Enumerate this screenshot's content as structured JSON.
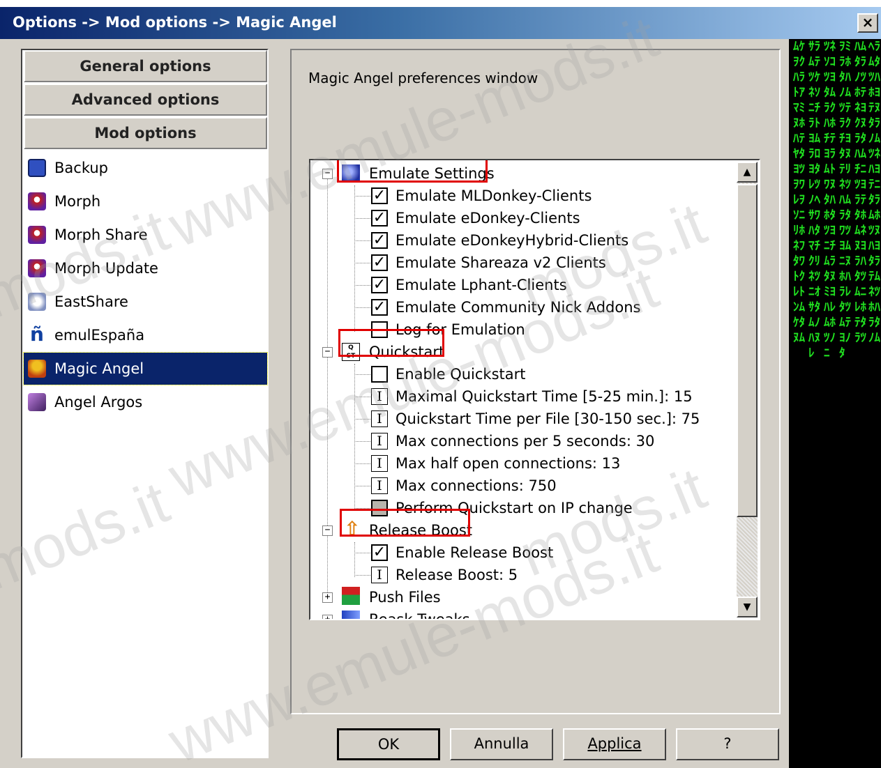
{
  "window": {
    "title": "Options -> Mod options -> Magic Angel",
    "close_label": "×"
  },
  "nav": {
    "groups": [
      {
        "label": "General options"
      },
      {
        "label": "Advanced options"
      },
      {
        "label": "Mod options"
      }
    ],
    "items": [
      {
        "label": "Backup",
        "icon": "floppy-disk-icon",
        "color": "#3050c0"
      },
      {
        "label": "Morph",
        "icon": "morph-mascot-icon",
        "color": "#c02020"
      },
      {
        "label": "Morph Share",
        "icon": "morph-mascot-icon",
        "color": "#c02020"
      },
      {
        "label": "Morph Update",
        "icon": "morph-mascot-icon",
        "color": "#c02020"
      },
      {
        "label": "EastShare",
        "icon": "eastshare-icon",
        "color": "#8090c0"
      },
      {
        "label": "emulEspaña",
        "icon": "n-tilde-icon",
        "color": "#1040a0"
      },
      {
        "label": "Magic Angel",
        "icon": "angel-icon",
        "color": "#f0c020",
        "selected": true
      },
      {
        "label": "Angel Argos",
        "icon": "argos-pyramid-icon",
        "color": "#8040a0"
      }
    ]
  },
  "main": {
    "description": "Magic Angel preferences window",
    "tree": {
      "groups": [
        {
          "label": "Emulate Settings",
          "icon": "emulate-icon",
          "expander": "−",
          "children": [
            {
              "type": "check",
              "checked": true,
              "label": "Emulate MLDonkey-Clients"
            },
            {
              "type": "check",
              "checked": true,
              "label": "Emulate eDonkey-Clients"
            },
            {
              "type": "check",
              "checked": true,
              "label": "Emulate eDonkeyHybrid-Clients"
            },
            {
              "type": "check",
              "checked": true,
              "label": "Emulate Shareaza v2 Clients"
            },
            {
              "type": "check",
              "checked": true,
              "label": "Emulate Lphant-Clients"
            },
            {
              "type": "check",
              "checked": true,
              "label": "Emulate Community Nick Addons"
            },
            {
              "type": "check",
              "checked": false,
              "label": "Log for Emulation"
            }
          ]
        },
        {
          "label": "Quickstart",
          "icon": "quickstart-icon",
          "expander": "−",
          "children": [
            {
              "type": "check",
              "checked": false,
              "label": "Enable Quickstart"
            },
            {
              "type": "input",
              "label": "Maximal Quickstart Time [5-25 min.]: 15"
            },
            {
              "type": "input",
              "label": "Quickstart Time per File [30-150 sec.]: 75"
            },
            {
              "type": "input",
              "label": "Max connections per 5 seconds: 30"
            },
            {
              "type": "input",
              "label": "Max half open connections: 13"
            },
            {
              "type": "input",
              "label": "Max connections: 750"
            },
            {
              "type": "check",
              "checked": false,
              "disabled": true,
              "label": "Perform Quickstart on IP change"
            }
          ]
        },
        {
          "label": "Release Boost",
          "icon": "release-boost-arrow-icon",
          "expander": "−",
          "children": [
            {
              "type": "check",
              "checked": true,
              "label": "Enable Release Boost"
            },
            {
              "type": "input",
              "label": "Release Boost: 5"
            }
          ]
        },
        {
          "label": "Push Files",
          "icon": "push-files-icon",
          "expander": "+",
          "children": []
        },
        {
          "label": "Reask Tweaks",
          "icon": "reask-tweaks-icon",
          "expander": "+",
          "children": []
        }
      ]
    }
  },
  "buttons": {
    "ok": "OK",
    "cancel": "Annulla",
    "apply": "Applica",
    "help": "?"
  },
  "watermark": {
    "text_a": "www.emule-mods.it",
    "text_b": "mods.it"
  },
  "colors": {
    "highlight": "#e00000",
    "selection": "#0a246a",
    "matrix_green": "#20e020"
  }
}
